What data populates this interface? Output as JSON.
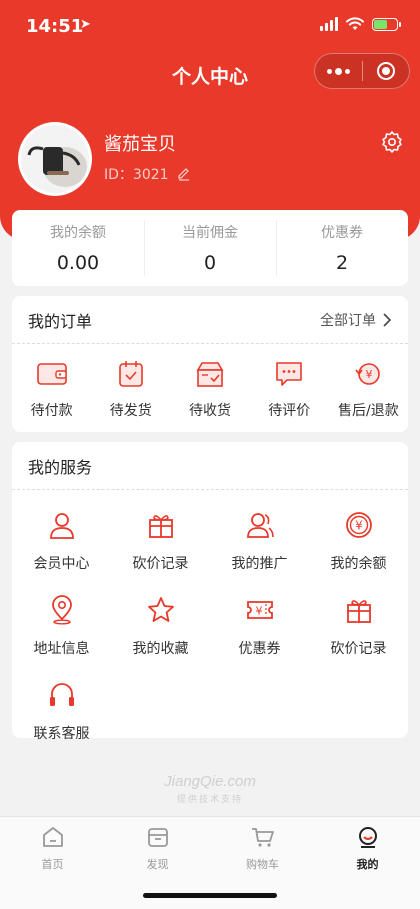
{
  "status_bar": {
    "time": "14:51",
    "location_glyph": "➤"
  },
  "nav": {
    "title": "个人中心"
  },
  "user": {
    "name": "酱茄宝贝",
    "id_text": "ID：3021"
  },
  "balances": [
    {
      "label": "我的余额",
      "value": "0.00"
    },
    {
      "label": "当前佣金",
      "value": "0"
    },
    {
      "label": "优惠券",
      "value": "2"
    }
  ],
  "orders": {
    "title": "我的订单",
    "all_label": "全部订单",
    "items": [
      {
        "label": "待付款",
        "icon": "wallet-icon"
      },
      {
        "label": "待发货",
        "icon": "box-check-icon"
      },
      {
        "label": "待收货",
        "icon": "delivery-box-icon"
      },
      {
        "label": "待评价",
        "icon": "comment-icon"
      },
      {
        "label": "售后/退款",
        "icon": "refund-icon"
      }
    ]
  },
  "services": {
    "title": "我的服务",
    "items": [
      {
        "label": "会员中心",
        "icon": "user-icon"
      },
      {
        "label": "砍价记录",
        "icon": "gift-icon"
      },
      {
        "label": "我的推广",
        "icon": "users-icon"
      },
      {
        "label": "我的余额",
        "icon": "yen-coin-icon"
      },
      {
        "label": "地址信息",
        "icon": "location-pin-icon"
      },
      {
        "label": "我的收藏",
        "icon": "star-icon"
      },
      {
        "label": "优惠券",
        "icon": "coupon-icon"
      },
      {
        "label": "砍价记录",
        "icon": "gift-icon"
      },
      {
        "label": "联系客服",
        "icon": "headset-icon"
      }
    ]
  },
  "footer": {
    "brand": "JiangQie.com",
    "tagline": "提供技术支持"
  },
  "tabbar": [
    {
      "label": "首页",
      "icon": "home-icon",
      "active": false
    },
    {
      "label": "发现",
      "icon": "discover-icon",
      "active": false
    },
    {
      "label": "购物车",
      "icon": "cart-icon",
      "active": false
    },
    {
      "label": "我的",
      "icon": "profile-icon",
      "active": true
    }
  ],
  "colors": {
    "accent": "#e8392a",
    "background": "#f2f2f2",
    "battery": "#7ce26c"
  }
}
